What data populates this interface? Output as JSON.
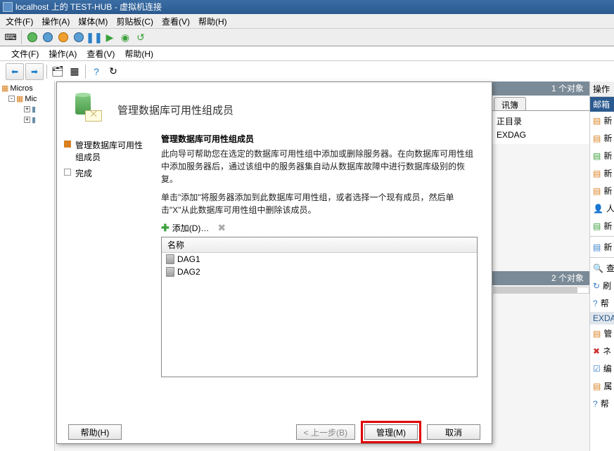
{
  "vm": {
    "title": "localhost 上的 TEST-HUB - 虚拟机连接",
    "menu": {
      "file": "文件(F)",
      "action": "操作(A)",
      "media": "媒体(M)",
      "clipboard": "剪贴板(C)",
      "view": "查看(V)",
      "help": "帮助(H)"
    }
  },
  "inner": {
    "menu": {
      "file": "文件(F)",
      "action": "操作(A)",
      "view": "查看(V)",
      "help": "帮助(H)"
    },
    "tree": {
      "root": "Micros",
      "child": "Mic"
    }
  },
  "right": {
    "header_count": "1 个对象",
    "tab1": "讯簿",
    "line1": "正目录",
    "line2": "EXDAG",
    "bottom_count": "2 个对象"
  },
  "actions": {
    "header": "操作",
    "section1": "邮箱",
    "items": [
      "新",
      "新",
      "新",
      "新",
      "新",
      "人",
      "新",
      "新"
    ],
    "misc": [
      "查",
      "刷",
      "帮"
    ],
    "section2": "EXDA",
    "items2": [
      "管",
      "ネ",
      "编",
      "属",
      "帮"
    ]
  },
  "wizard": {
    "title": "管理数据库可用性组成员",
    "steps": {
      "s1": "管理数据库可用性组成员",
      "s2": "完成"
    },
    "section_title": "管理数据库可用性组成员",
    "desc1": "此向导可帮助您在选定的数据库可用性组中添加或删除服务器。在向数据库可用性组中添加服务器后，通过该组中的服务器集自动从数据库故障中进行数据库级别的恢复。",
    "desc2": "单击\"添加\"将服务器添加到此数据库可用性组，或者选择一个现有成员，然后单击\"X\"从此数据库可用性组中删除该成员。",
    "add_label": "添加(D)…",
    "col_name": "名称",
    "rows": [
      "DAG1",
      "DAG2"
    ],
    "btn_help": "帮助(H)",
    "btn_back": "< 上一步(B)",
    "btn_manage": "管理(M)",
    "btn_cancel": "取消"
  }
}
